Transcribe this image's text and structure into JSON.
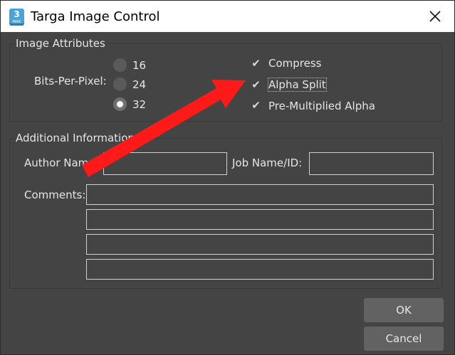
{
  "window": {
    "title": "Targa Image Control",
    "app_icon": {
      "name": "3ds-max-icon",
      "number": "3",
      "caption": "MAX"
    },
    "close_icon": "close-icon"
  },
  "image_attributes": {
    "title": "Image Attributes",
    "bits_per_pixel_label": "Bits-Per-Pixel:",
    "options": [
      {
        "label": "16",
        "checked": false
      },
      {
        "label": "24",
        "checked": false
      },
      {
        "label": "32",
        "checked": true
      }
    ],
    "checkboxes": [
      {
        "label": "Compress",
        "checked": true
      },
      {
        "label": "Alpha Split",
        "checked": true
      },
      {
        "label": "Pre-Multiplied Alpha",
        "checked": true
      }
    ]
  },
  "additional_information": {
    "title": "Additional Information",
    "author_label": "Author Name:",
    "author_value": "",
    "job_label": "Job Name/ID:",
    "job_value": "",
    "comments_label": "Comments:",
    "comment_lines": [
      "",
      "",
      "",
      ""
    ]
  },
  "buttons": {
    "ok": "OK",
    "cancel": "Cancel"
  },
  "annotation": {
    "arrow_color": "#ff1a1a"
  }
}
